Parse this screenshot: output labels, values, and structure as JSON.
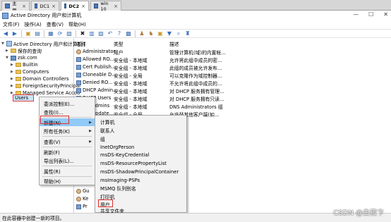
{
  "vm_tabs": [
    {
      "label": "主页",
      "active": false
    },
    {
      "label": "DC1",
      "active": false
    },
    {
      "label": "DC2",
      "active": true
    },
    {
      "label": "win 10",
      "active": false
    }
  ],
  "tab_close": "×",
  "window": {
    "title": "Active Directory 用户和计算机",
    "controls": {
      "minimize": "—",
      "maximize": "☐",
      "close": "✕"
    }
  },
  "menubar": [
    "文件(F)",
    "操作(A)",
    "查看(V)",
    "帮助(H)"
  ],
  "tree": {
    "root": "Active Directory 用户和计算机 [",
    "saved_queries": "保存的查询",
    "domain": "zsk.com",
    "children": [
      "Builtin",
      "Computers",
      "Domain Controllers",
      "ForeignSecurityPrincipal",
      "Managed Service Accou"
    ],
    "selected": "Users"
  },
  "list": {
    "columns": [
      "名称",
      "类型",
      "描述"
    ],
    "rows": [
      {
        "name": "Administrator",
        "type": "用户",
        "desc": "管理计算机(域)的内置帐..."
      },
      {
        "name": "Allowed RO...",
        "type": "安全组 - 本地域",
        "desc": "允许将此组中成员的密..."
      },
      {
        "name": "Cert Publish...",
        "type": "安全组 - 本地域",
        "desc": "此组的成员被允许发布..."
      },
      {
        "name": "Cloneable D...",
        "type": "安全组 - 全局",
        "desc": "可以克隆作为域控制器..."
      },
      {
        "name": "Denied RO...",
        "type": "安全组 - 本地域",
        "desc": "不允许将此组中成员的..."
      },
      {
        "name": "DHCP Admin...",
        "type": "安全组 - 本地域",
        "desc": "对 DHCP 服务拥有管理..."
      },
      {
        "name": "DHCP Users",
        "type": "安全组 - 本地域",
        "desc": "对 DHCP 服务拥有只读..."
      },
      {
        "name": "DnsAdmins",
        "type": "安全组 - 本地域",
        "desc": "DNS Administrators 组"
      },
      {
        "name": "DnsUpdate...",
        "type": "安全组 - 全局",
        "desc": "允许替其他客户端(如..."
      }
    ],
    "partial_rows": [
      "Gu",
      "Ke",
      "Pr"
    ]
  },
  "context_menu": {
    "items": [
      {
        "label": "委派控制(E)...",
        "submenu": false
      },
      {
        "label": "查找(I)...",
        "submenu": false
      },
      {
        "label": "新建(N)",
        "submenu": true,
        "highlighted": true
      },
      {
        "label": "所有任务(K)",
        "submenu": true
      },
      {
        "label": "查看(V)",
        "submenu": true
      },
      {
        "label": "刷新(F)",
        "submenu": false
      },
      {
        "label": "导出列表(L)...",
        "submenu": false
      },
      {
        "label": "属性(R)",
        "submenu": false
      },
      {
        "label": "帮助(H)",
        "submenu": false
      }
    ],
    "submenu_arrow": "▶"
  },
  "new_submenu": {
    "items": [
      "计算机",
      "联系人",
      "组",
      "InetOrgPerson",
      "msDS-KeyCredential",
      "msDS-ResourcePropertyList",
      "msDS-ShadowPrincipalContainer",
      "msImaging-PSPs",
      "MSMQ 队列别名",
      "打印机",
      "用户",
      "共享文件夹"
    ],
    "boxed": "用户"
  },
  "statusbar": {
    "text": "在此容器中创建一新的项目。"
  },
  "watermark": "CSDN @白夜卞",
  "colors": {
    "highlight": "#91c9f7",
    "annotation_red": "#e03030",
    "folder": "#e8c25a"
  }
}
